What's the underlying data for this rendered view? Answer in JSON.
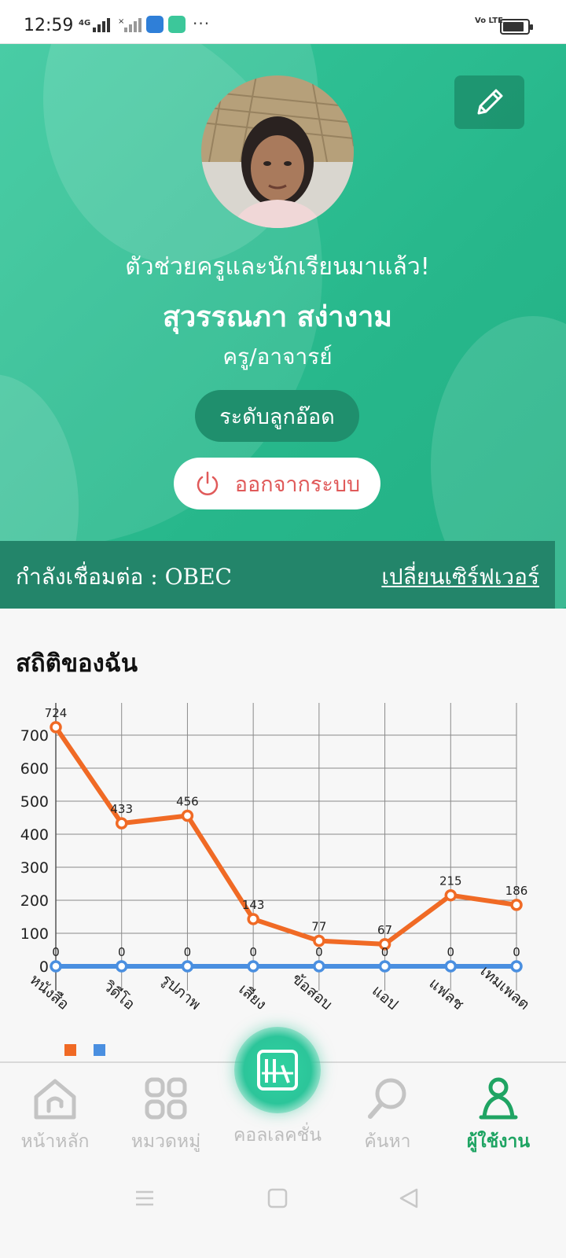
{
  "status_bar": {
    "time": "12:59",
    "network": "4G",
    "more": "···",
    "volte": "Vo LTE",
    "battery_level": 0.85
  },
  "profile": {
    "welcome": "ตัวช่วยครูและนักเรียนมาแล้ว!",
    "name": "สุวรรณภา สง่างาม",
    "role": "ครู/อาจารย์",
    "level_button": "ระดับลูกอ๊อด",
    "logout_button": "ออกจากระบบ"
  },
  "server": {
    "label": "กำลังเชื่อมต่อ : OBEC",
    "change_link": "เปลี่ยนเซิร์ฟเวอร์"
  },
  "stats": {
    "title": "สถิติของฉัน"
  },
  "chart_data": {
    "type": "line",
    "categories": [
      "หนังสือ",
      "วิดีโอ",
      "รูปภาพ",
      "เสียง",
      "ข้อสอบ",
      "แอป",
      "แฟลช",
      "เทมเพลต"
    ],
    "series": [
      {
        "values": [
          724,
          433,
          456,
          143,
          77,
          67,
          215,
          186
        ],
        "color": "#f06a25"
      },
      {
        "values": [
          0,
          0,
          0,
          0,
          0,
          0,
          0,
          0
        ],
        "color": "#4a8fe0"
      }
    ],
    "ylim": [
      0,
      780
    ],
    "yticks": [
      0,
      100,
      200,
      300,
      400,
      500,
      600,
      700
    ],
    "grid": true,
    "legend": "bottom-left"
  },
  "bottom_nav": {
    "items": [
      {
        "label": "หน้าหลัก",
        "icon": "home-icon"
      },
      {
        "label": "หมวดหมู่",
        "icon": "category-icon"
      },
      {
        "label": "คอลเลคชั่น",
        "icon": "collection-icon"
      },
      {
        "label": "ค้นหา",
        "icon": "search-icon"
      },
      {
        "label": "ผู้ใช้งาน",
        "icon": "user-icon"
      }
    ],
    "active_index": 4,
    "accent": "#1fa463"
  }
}
